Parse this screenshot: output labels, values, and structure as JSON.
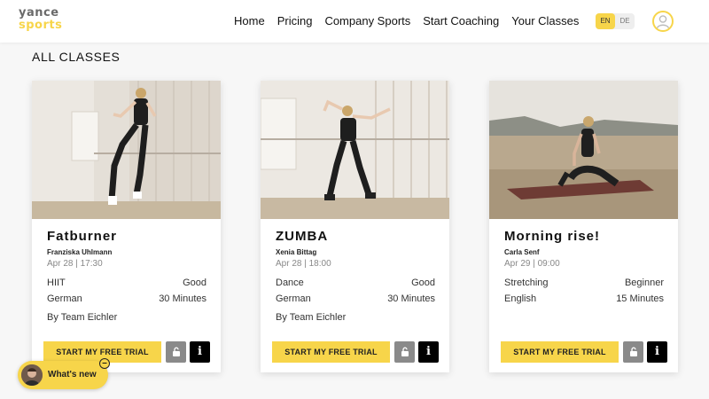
{
  "header": {
    "logo_line1": "yance",
    "logo_line2": "sports",
    "nav": [
      "Home",
      "Pricing",
      "Company Sports",
      "Start Coaching",
      "Your Classes"
    ],
    "lang": {
      "en": "EN",
      "de": "DE",
      "selected": "EN"
    }
  },
  "main": {
    "section_title": "ALL CLASSES",
    "cards": [
      {
        "title": "Fatburner",
        "coach": "Franziska Uhlmann",
        "date": "Apr 28 | 17:30",
        "category": "HIIT",
        "level": "Good",
        "language": "German",
        "duration": "30 Minutes",
        "team": "By Team Eichler",
        "cta": "START MY FREE TRIAL",
        "info": "i"
      },
      {
        "title": "ZUMBA",
        "coach": "Xenia Bittag",
        "date": "Apr 28 | 18:00",
        "category": "Dance",
        "level": "Good",
        "language": "German",
        "duration": "30 Minutes",
        "team": "By Team Eichler",
        "cta": "START MY FREE TRIAL",
        "info": "i"
      },
      {
        "title": "Morning rise!",
        "coach": "Carla Senf",
        "date": "Apr 29 | 09:00",
        "category": "Stretching",
        "level": "Beginner",
        "language": "English",
        "duration": "15 Minutes",
        "cta": "START MY FREE TRIAL",
        "info": "i"
      }
    ]
  },
  "widget": {
    "whats_new": "What's new",
    "minimize": "–"
  },
  "colors": {
    "accent": "#f7d54a",
    "lock_button": "#8a8a8a",
    "info_button": "#000000"
  },
  "icons": [
    "user-icon",
    "lock-icon",
    "info-icon",
    "minimize-icon"
  ]
}
